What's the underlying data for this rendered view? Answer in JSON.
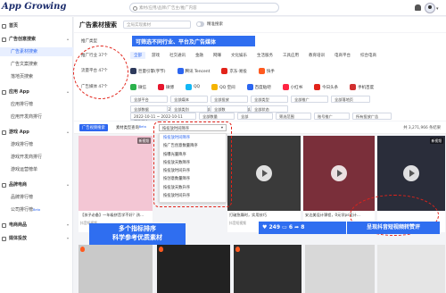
{
  "app": {
    "logo": "App Growing",
    "search_placeholder": "素材/应用/品牌/广告主/推广内容"
  },
  "sidebar": {
    "items": [
      {
        "label": "首页",
        "type": "group"
      },
      {
        "label": "广告创意搜索",
        "type": "group"
      },
      {
        "label": "广告素材搜索",
        "type": "sub",
        "active": true
      },
      {
        "label": "广告文案搜索",
        "type": "sub"
      },
      {
        "label": "落地页搜索",
        "type": "sub"
      },
      {
        "label": "应用 App",
        "type": "group"
      },
      {
        "label": "应用排行榜",
        "type": "sub"
      },
      {
        "label": "应用开发商排行",
        "type": "sub"
      },
      {
        "label": "游戏 App",
        "type": "group"
      },
      {
        "label": "游戏排行榜",
        "type": "sub"
      },
      {
        "label": "游戏开发商排行",
        "type": "sub"
      },
      {
        "label": "游戏运营榜单",
        "type": "sub"
      },
      {
        "label": "品牌电商",
        "type": "group"
      },
      {
        "label": "品牌排行榜",
        "type": "sub"
      },
      {
        "label": "公司排行榜",
        "type": "sub",
        "beta": "Beta"
      },
      {
        "label": "电商商品",
        "type": "group"
      },
      {
        "label": "媒体投放",
        "type": "group"
      }
    ]
  },
  "main": {
    "title": "广告素材搜索",
    "search_placeholder": "全局实现素材",
    "toggle_label": "精准搜索"
  },
  "filters": {
    "promo_label": "推广类型",
    "industry_label": "推广行业 37个",
    "platform_label": "流量平台 47个",
    "media_label": "广告媒体 47个",
    "industry_chips": [
      "全部",
      "游戏",
      "社交通讯",
      "金融",
      "网赚",
      "文化娱乐",
      "生活服务",
      "工具应用",
      "教育培训",
      "电商平台",
      "综合电商"
    ],
    "platforms": [
      "巨量引擎(字节)",
      "腾讯 Tencent",
      "京东·易投",
      "快手"
    ],
    "medias": [
      "微信",
      "微博",
      "QQ",
      "QQ 空间",
      "百度贴吧",
      "小红书",
      "今日头条",
      "手机百度"
    ],
    "dd_row1": [
      "全部平台",
      "全部媒体",
      "全部投放",
      "全部类型",
      "全部推广",
      "全部落地页"
    ],
    "date_range1": "2022-10-11 ~ 2022-10-11",
    "dd_row2": [
      "全部类型",
      "全部广告"
    ],
    "dd_row3": [
      "全部显示",
      "全部数据",
      "全部类别",
      "全部数",
      "全部状态"
    ],
    "date_range2": "2022-10-11 ~ 2022-10-11",
    "dd_row3b": [
      "全部数量",
      "全部",
      "筛选范围",
      "账号推广",
      "所有投放广告"
    ]
  },
  "annotations": {
    "banner": "可筛选不同行业、平台及广告媒体",
    "left_box_line1": "多个指标排序",
    "left_box_line2": "科学参考优质素材",
    "right_box": "呈现抖音短视频转赞评",
    "stats": [
      "249",
      "6",
      "8"
    ]
  },
  "result_bar": {
    "tabs": [
      "广告视频搜索",
      "素材类型查询"
    ],
    "beta": "Beta",
    "sort_current": "按投放时间降序",
    "count": "共 3,271,966 条结果"
  },
  "sort_menu": [
    "按投放时间降序",
    "按广告创意数量降序",
    "按曝光量降序",
    "按投放天数降序",
    "按投放时间升序",
    "按创意数量降序",
    "按投放天数升序",
    "按投放时间升序"
  ],
  "cards": [
    {
      "tag": "新视频",
      "caption": "【孩子必备】一年级拼音学不好？孩…",
      "meta": "抖音短视频"
    },
    {
      "tag": "",
      "caption": "",
      "meta": ""
    },
    {
      "tag": "新视频",
      "caption": "打破急躁时，实用技巧",
      "meta": "抖音短视频"
    },
    {
      "tag": "新视频",
      "caption": "安达美设计课程，0元学ps设计…",
      "meta": "抖音短视频"
    },
    {
      "tag": "新视频",
      "caption": "",
      "meta": ""
    }
  ]
}
